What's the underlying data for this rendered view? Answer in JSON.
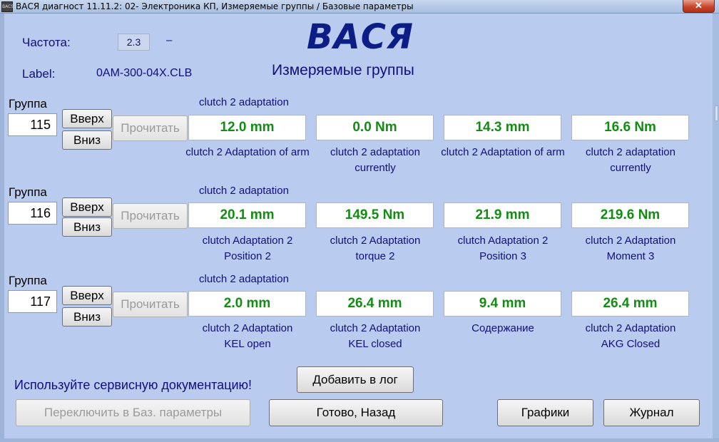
{
  "window": {
    "icon_text": "BACS",
    "title": "ВАСЯ диагност 11.11.2: 02- Электроника КП,  Измеряемые группы / Базовые параметры",
    "close_glyph": "✕"
  },
  "header": {
    "frequency_label": "Частота:",
    "frequency_value": "2.3",
    "frequency_dash": "–",
    "label_label": "Label:",
    "label_value": "0AM-300-04X.CLB",
    "brand": "ВАСЯ",
    "subtitle": "Измеряемые группы"
  },
  "groups": [
    {
      "group_label": "Группа",
      "number": "115",
      "up_label": "Вверх",
      "down_label": "Вниз",
      "read_label": "Прочитать",
      "caption": "clutch 2 adaptation",
      "fields": [
        {
          "value": "12.0 mm",
          "label1": "clutch 2 Adaptation of arm",
          "label2": ""
        },
        {
          "value": "0.0 Nm",
          "label1": "clutch 2 adaptation",
          "label2": "currently"
        },
        {
          "value": "14.3 mm",
          "label1": "clutch 2 Adaptation of arm",
          "label2": ""
        },
        {
          "value": "16.6 Nm",
          "label1": "clutch 2 adaptation",
          "label2": "currently"
        }
      ]
    },
    {
      "group_label": "Группа",
      "number": "116",
      "up_label": "Вверх",
      "down_label": "Вниз",
      "read_label": "Прочитать",
      "caption": "clutch 2 adaptation",
      "fields": [
        {
          "value": "20.1 mm",
          "label1": "clutch Adaptation 2",
          "label2": "Position 2"
        },
        {
          "value": "149.5 Nm",
          "label1": "clutch 2 Adaptation",
          "label2": "torque 2"
        },
        {
          "value": "21.9 mm",
          "label1": "clutch Adaptation 2",
          "label2": "Position 3"
        },
        {
          "value": "219.6 Nm",
          "label1": "clutch 2 Adaptation",
          "label2": "Moment 3"
        }
      ]
    },
    {
      "group_label": "Группа",
      "number": "117",
      "up_label": "Вверх",
      "down_label": "Вниз",
      "read_label": "Прочитать",
      "caption": "clutch 2 adaptation",
      "fields": [
        {
          "value": "2.0 mm",
          "label1": "clutch 2 Adaptation",
          "label2": "KEL open"
        },
        {
          "value": "26.4 mm",
          "label1": "clutch 2 Adaptation",
          "label2": "KEL closed"
        },
        {
          "value": "9.4 mm",
          "label1": "Содержание",
          "label2": ""
        },
        {
          "value": "26.4 mm",
          "label1": "clutch 2 Adaptation",
          "label2": "AKG Closed"
        }
      ]
    }
  ],
  "footer": {
    "warning": "Используйте сервисную документацию!",
    "add_log": "Добавить в лог",
    "switch_basic": "Переключить в Баз. параметры",
    "done_back": "Готово, Назад",
    "graphs": "Графики",
    "journal": "Журнал"
  },
  "colors": {
    "value_text": "#128c12",
    "label_text": "#10107a",
    "background": "#b9cbee"
  }
}
